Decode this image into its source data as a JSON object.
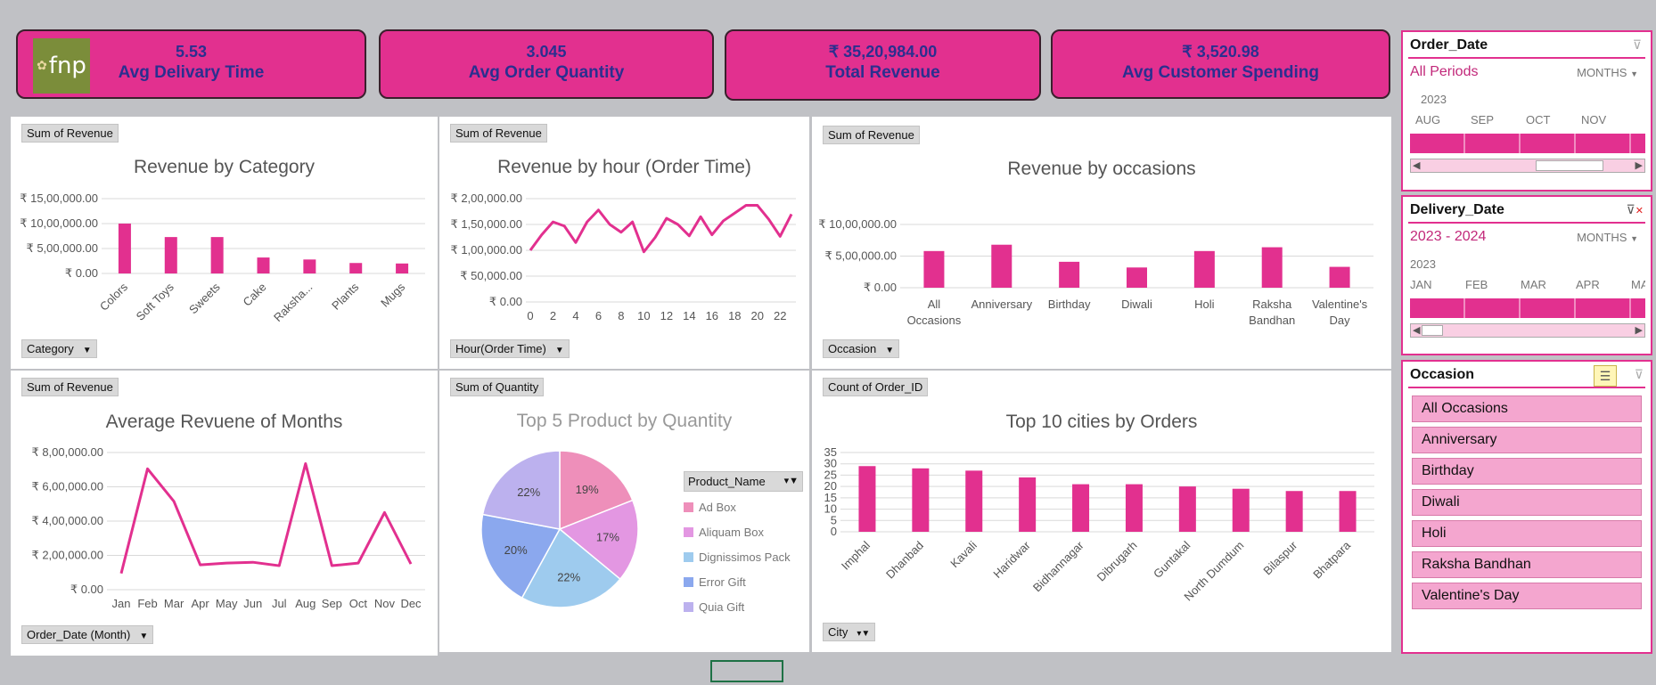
{
  "kpis": [
    {
      "value": "5.53",
      "label": "Avg Delivary Time"
    },
    {
      "value": "3.045",
      "label": "Avg Order Quantity"
    },
    {
      "value": "₹ 35,20,984.00",
      "label": "Total Revenue"
    },
    {
      "value": "₹ 3,520.98",
      "label": "Avg Customer Spending"
    }
  ],
  "logo_text": "fnp",
  "colors": {
    "accent": "#e2308f",
    "kpi_text": "#2b2f8f",
    "bar": "#e2308f"
  },
  "chart_data": [
    {
      "type": "bar",
      "field_button": "Sum of Revenue",
      "axis_button": "Category",
      "title": "Revenue by Category",
      "categories": [
        "Colors",
        "Soft Toys",
        "Sweets",
        "Cake",
        "Raksha...",
        "Plants",
        "Mugs"
      ],
      "values": [
        1000000,
        730000,
        730000,
        320000,
        280000,
        210000,
        200000
      ],
      "yticks": [
        "₹ 0.00",
        "₹ 5,00,000.00",
        "₹ 10,00,000.00",
        "₹ 15,00,000.00"
      ],
      "ylim": [
        0,
        1500000
      ]
    },
    {
      "type": "line",
      "field_button": "Sum of Revenue",
      "axis_button": "Hour(Order Time)",
      "title": "Revenue by hour (Order Time)",
      "x": [
        0,
        1,
        2,
        3,
        4,
        5,
        6,
        7,
        8,
        9,
        10,
        11,
        12,
        13,
        14,
        15,
        16,
        17,
        18,
        19,
        20,
        21,
        22,
        23
      ],
      "values": [
        100000,
        130000,
        155000,
        147000,
        115000,
        155000,
        178000,
        150000,
        135000,
        155000,
        97000,
        125000,
        162000,
        150000,
        128000,
        165000,
        130000,
        157000,
        172000,
        187000,
        187000,
        160000,
        127000,
        170000
      ],
      "xticks": [
        "0",
        "2",
        "4",
        "6",
        "8",
        "10",
        "12",
        "14",
        "16",
        "18",
        "20",
        "22"
      ],
      "yticks": [
        "₹ 0.00",
        "₹ 50,000.00",
        "₹ 1,00,000.00",
        "₹ 1,50,000.00",
        "₹ 2,00,000.00"
      ],
      "ylim": [
        0,
        200000
      ]
    },
    {
      "type": "bar",
      "field_button": "Sum of Revenue",
      "axis_button": "Occasion",
      "title": "Revenue by occasions",
      "categories": [
        [
          "All",
          "Occasions"
        ],
        [
          "Anniversary"
        ],
        [
          "Birthday"
        ],
        [
          "Diwali"
        ],
        [
          "Holi"
        ],
        [
          "Raksha",
          "Bandhan"
        ],
        [
          "Valentine's",
          "Day"
        ]
      ],
      "values": [
        580000,
        680000,
        410000,
        320000,
        580000,
        640000,
        330000
      ],
      "yticks": [
        "₹ 0.00",
        "₹ 5,00,000.00",
        "₹ 10,00,000.00"
      ],
      "ylim": [
        0,
        1000000
      ]
    },
    {
      "type": "line",
      "field_button": "Sum of Revenue",
      "axis_button": "Order_Date (Month)",
      "title": "Average Revuene of Months",
      "categories": [
        "Jan",
        "Feb",
        "Mar",
        "Apr",
        "May",
        "Jun",
        "Jul",
        "Aug",
        "Sep",
        "Oct",
        "Nov",
        "Dec"
      ],
      "values": [
        950000,
        7050000,
        5150000,
        1450000,
        1550000,
        1600000,
        1400000,
        7350000,
        1400000,
        1550000,
        4500000,
        1500000
      ],
      "yticks": [
        "₹ 0.00",
        "₹ 2,00,000.00",
        "₹ 4,00,000.00",
        "₹ 6,00,000.00",
        "₹ 8,00,000.00"
      ],
      "ylim": [
        0,
        8000000
      ]
    },
    {
      "type": "pie",
      "field_button": "Sum of Quantity",
      "legend_header": "Product_Name",
      "title": "Top 5 Product by Quantity",
      "slices": [
        {
          "name": "Ad Box",
          "value": 19,
          "label": "19%",
          "color": "#ee8fba"
        },
        {
          "name": "Aliquam Box",
          "value": 17,
          "label": "17%",
          "color": "#e397e2"
        },
        {
          "name": "Dignissimos Pack",
          "value": 22,
          "label": "22%",
          "color": "#9ecbee"
        },
        {
          "name": "Error Gift",
          "value": 20,
          "label": "20%",
          "color": "#8ba8ee"
        },
        {
          "name": "Quia Gift",
          "value": 22,
          "label": "22%",
          "color": "#bcb1ee"
        }
      ]
    },
    {
      "type": "bar",
      "field_button": "Count of Order_ID",
      "axis_button": "City",
      "title": "Top 10 cities by Orders",
      "categories": [
        "Imphal",
        "Dhanbad",
        "Kavali",
        "Haridwar",
        "Bidhannagar",
        "Dibrugarh",
        "Guntakal",
        "North Dumdum",
        "Bilaspur",
        "Bhatpara"
      ],
      "values": [
        29,
        28,
        27,
        24,
        21,
        21,
        20,
        19,
        18,
        18
      ],
      "yticks": [
        "0",
        "5",
        "10",
        "15",
        "20",
        "25",
        "30",
        "35"
      ],
      "ylim": [
        0,
        35
      ]
    }
  ],
  "slicers": {
    "order_date": {
      "title": "Order_Date",
      "period": "All Periods",
      "level": "MONTHS",
      "year": "2023",
      "months": [
        "AUG",
        "SEP",
        "OCT",
        "NOV"
      ]
    },
    "delivery_date": {
      "title": "Delivery_Date",
      "period": "2023 - 2024",
      "level": "MONTHS",
      "year": "2023",
      "months": [
        "JAN",
        "FEB",
        "MAR",
        "APR",
        "MA"
      ]
    },
    "occasion": {
      "title": "Occasion",
      "items": [
        "All Occasions",
        "Anniversary",
        "Birthday",
        "Diwali",
        "Holi",
        "Raksha Bandhan",
        "Valentine's Day"
      ]
    }
  }
}
